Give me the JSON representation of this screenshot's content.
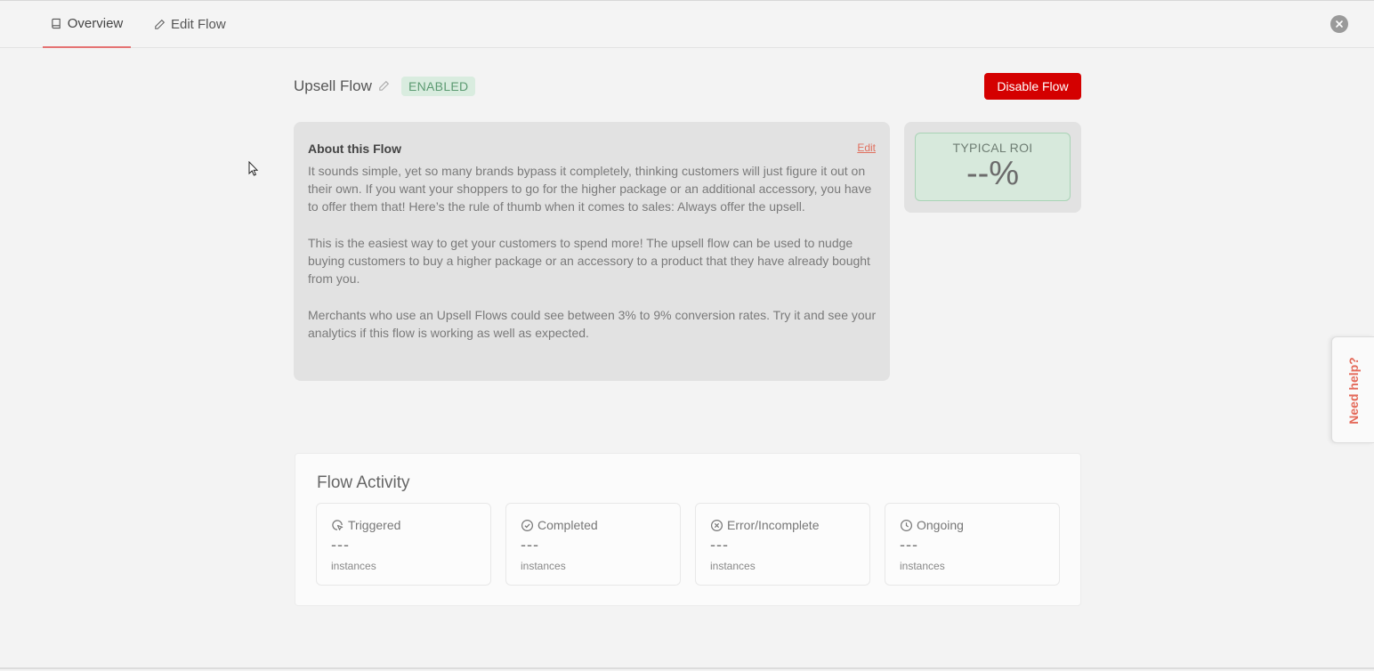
{
  "tabs": [
    {
      "label": "Overview",
      "icon": "book-icon",
      "active": true
    },
    {
      "label": "Edit Flow",
      "icon": "pencil-icon",
      "active": false
    }
  ],
  "flow": {
    "title": "Upsell Flow",
    "status": "ENABLED",
    "disable_label": "Disable Flow"
  },
  "about": {
    "title": "About this Flow",
    "edit_label": "Edit",
    "paragraphs": [
      "It sounds simple, yet so many brands bypass it completely, thinking customers will just figure it out on their own. If you want your shoppers to go for the higher package or an additional accessory, you have to offer them that! Here’s the rule of thumb when it comes to sales: Always offer the upsell.",
      "This is the easiest way to get your customers to spend more! The upsell flow can be used to nudge buying customers to buy a higher package or an accessory to a product that they have already bought from you.",
      "Merchants who use an Upsell Flows could see between 3% to 9% conversion rates. Try it and see your analytics if this flow is working as well as expected."
    ]
  },
  "roi": {
    "label": "TYPICAL ROI",
    "value": "--%"
  },
  "activity": {
    "title": "Flow Activity",
    "stats": [
      {
        "label": "Triggered",
        "value": "---",
        "unit": "instances",
        "icon": "cursor-click-icon"
      },
      {
        "label": "Completed",
        "value": "---",
        "unit": "instances",
        "icon": "check-circle-icon"
      },
      {
        "label": "Error/Incomplete",
        "value": "---",
        "unit": "instances",
        "icon": "x-circle-icon"
      },
      {
        "label": "Ongoing",
        "value": "---",
        "unit": "instances",
        "icon": "clock-icon"
      }
    ]
  },
  "help": {
    "label": "Need help?"
  },
  "colors": {
    "accent_red": "#d40000",
    "enabled_green": "#5b9a71",
    "edit_link": "#e0705f"
  }
}
